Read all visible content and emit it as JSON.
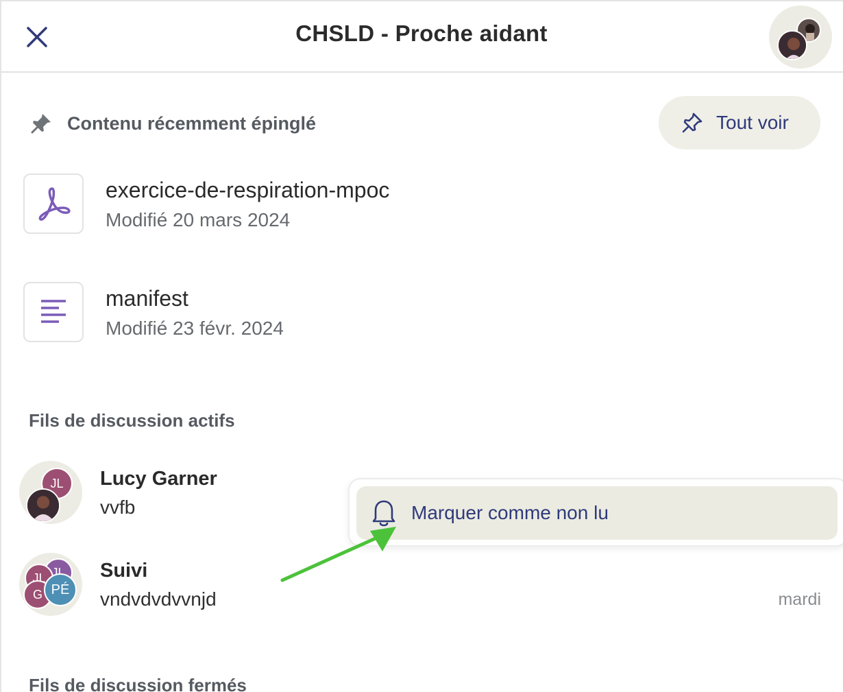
{
  "header": {
    "title": "CHSLD - Proche aidant",
    "close_icon": "close-icon"
  },
  "pinned": {
    "section_label": "Contenu récemment épinglé",
    "see_all_label": "Tout voir",
    "files": [
      {
        "name": "exercice-de-respiration-mpoc",
        "meta": "Modifié 20 mars 2024",
        "icon": "pdf-icon"
      },
      {
        "name": "manifest",
        "meta": "Modifié 23 févr. 2024",
        "icon": "text-document-icon"
      }
    ]
  },
  "active_threads": {
    "title": "Fils de discussion actifs",
    "items": [
      {
        "name": "Lucy Garner",
        "message": "vvfb",
        "date": "",
        "initials": [
          "JL"
        ]
      },
      {
        "name": "Suivi",
        "message": "vndvdvdvvnjd",
        "date": "mardi",
        "initials": [
          "JL",
          "JL",
          "G",
          "PÉ"
        ]
      }
    ]
  },
  "closed_threads": {
    "title": "Fils de discussion fermés"
  },
  "context_menu": {
    "mark_unread_label": "Marquer comme non lu",
    "icon": "bell-icon"
  },
  "colors": {
    "accent": "#2f3a7a",
    "annotation_arrow": "#4cc23a",
    "avatar_jl": "#9c4f72",
    "avatar_pe": "#4d8fb5",
    "file_icon": "#7a5cb8"
  }
}
